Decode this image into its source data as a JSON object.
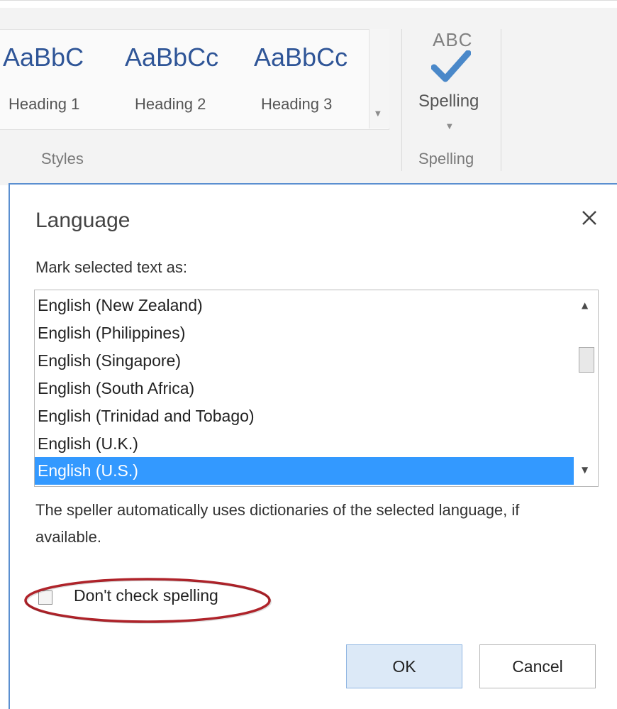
{
  "ribbon": {
    "styles": [
      {
        "preview": "AaBbC",
        "label": "Heading 1"
      },
      {
        "preview": "AaBbCc",
        "label": "Heading 2"
      },
      {
        "preview": "AaBbCc",
        "label": "Heading 3"
      }
    ],
    "styles_group_label": "Styles",
    "spelling": {
      "icon_text": "ABC",
      "button_label": "Spelling",
      "group_label": "Spelling"
    },
    "colors": {
      "style_preview": "#2f5597",
      "check_mark": "#4a88c9"
    }
  },
  "dialog": {
    "title": "Language",
    "close_icon": "close-icon",
    "mark_label": "Mark selected text as:",
    "languages": [
      "English (New Zealand)",
      "English (Philippines)",
      "English (Singapore)",
      "English (South Africa)",
      "English (Trinidad and Tobago)",
      "English (U.K.)",
      "English (U.S.)"
    ],
    "selected_language": "English (U.S.)",
    "description": "The speller automatically uses dictionaries of the selected language, if available.",
    "dont_check_label": "Don't check spelling",
    "dont_check_checked": false,
    "ok_label": "OK",
    "cancel_label": "Cancel",
    "colors": {
      "selection": "#3399ff",
      "highlight_ring": "#b0232a"
    }
  }
}
